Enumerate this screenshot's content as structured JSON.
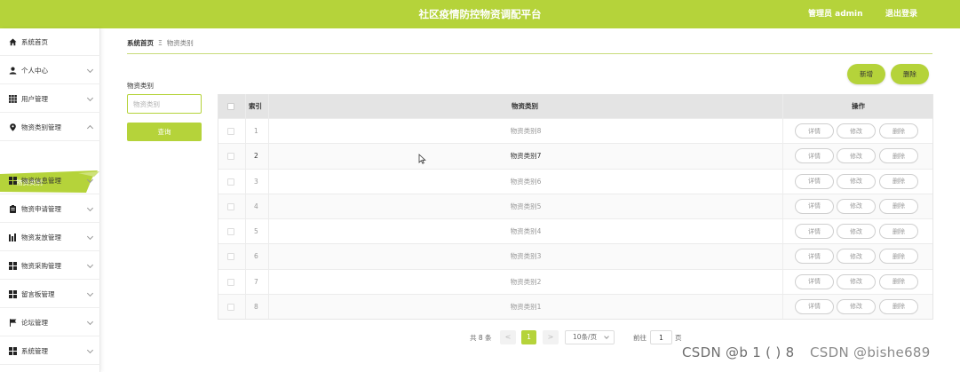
{
  "header": {
    "title": "社区疫情防控物资调配平台",
    "user": "管理员 admin",
    "logout": "退出登录",
    "accent": "#b5d33a"
  },
  "sidebar": {
    "items": [
      {
        "label": "系统首页",
        "icon": "home-icon"
      },
      {
        "label": "个人中心",
        "icon": "person-icon"
      },
      {
        "label": "用户管理",
        "icon": "grid-icon"
      },
      {
        "label": "物资类别管理",
        "icon": "pin-icon",
        "expanded": true
      },
      {
        "label": "物资信息管理",
        "icon": "grid-icon"
      },
      {
        "label": "物资申请管理",
        "icon": "clipboard-icon"
      },
      {
        "label": "物资发放管理",
        "icon": "chart-icon"
      },
      {
        "label": "物资采购管理",
        "icon": "grid-icon"
      },
      {
        "label": "留言板管理",
        "icon": "grid-icon"
      },
      {
        "label": "论坛管理",
        "icon": "flag-icon"
      },
      {
        "label": "系统管理",
        "icon": "grid-icon"
      }
    ],
    "active_sub": "物资类别"
  },
  "breadcrumb": {
    "home": "系统首页",
    "separator": "Ξ",
    "current": "物资类别"
  },
  "search": {
    "label": "物资类别",
    "placeholder": "物资类别",
    "button": "查询"
  },
  "actions": {
    "add": "新增",
    "delete": "删除"
  },
  "table": {
    "headers": {
      "index": "索引",
      "category": "物资类别",
      "ops": "操作"
    },
    "ops": {
      "detail": "详情",
      "edit": "修改",
      "remove": "删除"
    },
    "rows": [
      {
        "index": "1",
        "category": "物资类别8"
      },
      {
        "index": "2",
        "category": "物资类别7"
      },
      {
        "index": "3",
        "category": "物资类别6"
      },
      {
        "index": "4",
        "category": "物资类别5"
      },
      {
        "index": "5",
        "category": "物资类别4"
      },
      {
        "index": "6",
        "category": "物资类别3"
      },
      {
        "index": "7",
        "category": "物资类别2"
      },
      {
        "index": "8",
        "category": "物资类别1"
      }
    ]
  },
  "pager": {
    "total": "共 8 条",
    "prev": "<",
    "current": "1",
    "next": ">",
    "page_size": "10条/页",
    "goto_prefix": "前往",
    "goto_value": "1",
    "goto_suffix": "页"
  },
  "watermark": {
    "primary": "CSDN @b 1  (  ) 8",
    "secondary": "CSDN @bishe689"
  }
}
